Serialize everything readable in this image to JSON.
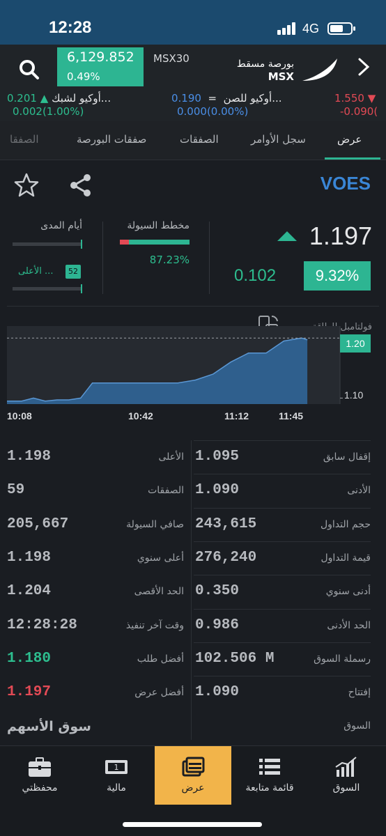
{
  "status": {
    "time": "12:28",
    "network": "4G"
  },
  "header": {
    "index_value": "6,129.852",
    "index_change": "0.49%",
    "index_name": "MSX30",
    "brand_ar": "بورصة مسقط",
    "brand_en": "MSX"
  },
  "ticker": [
    {
      "name": "أوكيو لشبك...",
      "price": "0.201",
      "change": "0.002(1.00%)",
      "direction": "up",
      "color": "#2dbe8f"
    },
    {
      "name": "أوكيو للصن...",
      "price": "0.190",
      "change": "0.000(0.00%)",
      "direction": "flat",
      "color": "#4a8ee6"
    },
    {
      "name": "",
      "price": "1.550",
      "change": "-0.090(",
      "direction": "down",
      "color": "#e24a55"
    }
  ],
  "tabs": [
    "عرض",
    "سجل الأوامر",
    "الصفقات",
    "صفقات البورصة",
    "الصفقا"
  ],
  "active_tab": 0,
  "symbol": "VOES",
  "price": {
    "last": "1.197",
    "change": "0.102",
    "change_pct": "9.32%"
  },
  "liquidity": {
    "label": "مخطط السيولة",
    "value": "87.23%",
    "fraction": 0.1277
  },
  "range": {
    "label": "أيام المدى",
    "high_label": "الأعلى ...",
    "high_badge": "52"
  },
  "chart_data": {
    "type": "area",
    "title": "فولتامبل للطاقة",
    "x_ticks": [
      "10:08",
      "10:42",
      "11:12",
      "11:45"
    ],
    "y_ticks": [
      "1.20",
      "1.10"
    ],
    "reference_line": 1.2,
    "x": [
      "10:08",
      "10:13",
      "10:17",
      "10:21",
      "10:25",
      "10:29",
      "10:33",
      "10:37",
      "10:42",
      "10:48",
      "10:54",
      "11:00",
      "11:06",
      "11:12",
      "11:18",
      "11:24",
      "11:30",
      "11:36",
      "11:42",
      "11:48",
      "11:50"
    ],
    "values": [
      1.095,
      1.095,
      1.1,
      1.095,
      1.097,
      1.097,
      1.1,
      1.125,
      1.125,
      1.125,
      1.125,
      1.125,
      1.125,
      1.13,
      1.14,
      1.16,
      1.175,
      1.175,
      1.195,
      1.2,
      1.197
    ],
    "ylim": [
      1.09,
      1.22
    ]
  },
  "stats": [
    {
      "left_label": "الأعلى",
      "left_value": "1.198",
      "right_label": "إقفال سابق",
      "right_value": "1.095"
    },
    {
      "left_label": "الصفقات",
      "left_value": "59",
      "right_label": "الأدنى",
      "right_value": "1.090"
    },
    {
      "left_label": "صافي السيولة",
      "left_value": "205,667",
      "right_label": "حجم التداول",
      "right_value": "243,615"
    },
    {
      "left_label": "أعلى سنوي",
      "left_value": "1.198",
      "right_label": "قيمة التداول",
      "right_value": "276,240"
    },
    {
      "left_label": "الحد الأقصى",
      "left_value": "1.204",
      "right_label": "أدنى سنوي",
      "right_value": "0.350"
    },
    {
      "left_label": "وقت آخر تنفيذ",
      "left_value": "12:28:28",
      "right_label": "الحد الأدنى",
      "right_value": "0.986"
    },
    {
      "left_label": "أفضل طلب",
      "left_value": "1.180",
      "right_label": "رسملة السوق",
      "right_value": "102.506 M"
    },
    {
      "left_label": "أفضل عرض",
      "left_value": "1.197",
      "right_label": "إفتتاح",
      "right_value": "1.090"
    }
  ],
  "market": {
    "label": "السوق",
    "value": "سوق الأسهم"
  },
  "nav": [
    {
      "label": "محفظتي",
      "icon": "briefcase-icon"
    },
    {
      "label": "مالية",
      "icon": "cash-icon"
    },
    {
      "label": "عرض",
      "icon": "window-icon"
    },
    {
      "label": "قائمة متابعة",
      "icon": "list-icon"
    },
    {
      "label": "السوق",
      "icon": "chart-icon"
    }
  ],
  "active_nav": 2,
  "colors": {
    "up": "#2dbe8f",
    "down": "#e24a55",
    "flat": "#4a8ee6",
    "accent": "#f2b44a",
    "header": "#1b4a6e"
  }
}
